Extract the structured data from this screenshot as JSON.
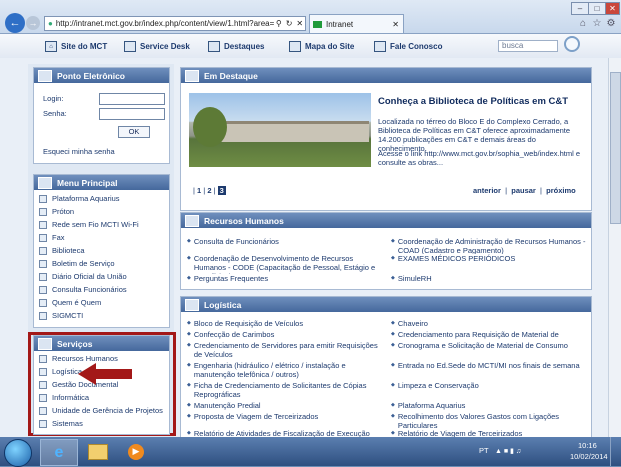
{
  "browser": {
    "url": "http://intranet.mct.gov.br/index.php/content/view/1.html?area=se",
    "tab_title": "Intranet"
  },
  "topnav": {
    "items": [
      "Site do MCT",
      "Service Desk",
      "Destaques",
      "Mapa do Site",
      "Fale Conosco"
    ],
    "search_placeholder": "busca"
  },
  "ponto": {
    "title": "Ponto Eletrônico",
    "login_label": "Login:",
    "senha_label": "Senha:",
    "ok_label": "OK",
    "forgot": "Esqueci minha senha"
  },
  "menu": {
    "title": "Menu Principal",
    "items": [
      "Plataforma Aquarius",
      "Próton",
      "Rede sem Fio MCTI Wi-Fi",
      "Fax",
      "Biblioteca",
      "Boletim de Serviço",
      "Diário Oficial da União",
      "Consulta Funcionários",
      "Quem é Quem",
      "SIGMCTI"
    ]
  },
  "servicos": {
    "title": "Serviços",
    "items": [
      "Recursos Humanos",
      "Logística",
      "Gestão Documental",
      "Informática",
      "Unidade de Gerência de Projetos",
      "Sistemas"
    ]
  },
  "destaque": {
    "title": "Em Destaque",
    "headline": "Conheça a Biblioteca de Políticas em C&T",
    "text": "Localizada no térreo do Bloco E do Complexo Cerrado, a Biblioteca de Políticas em C&T oferece aproximadamente 14.200 publicações em C&T e demais áreas do conhecimento.",
    "link_text": "Acesse o link http://www.mct.gov.br/sophia_web/index.html e consulte as obras...",
    "pages": [
      "1",
      "2",
      "3"
    ],
    "controls": [
      "anterior",
      "pausar",
      "próximo"
    ]
  },
  "rh": {
    "title": "Recursos Humanos",
    "left": [
      "Consulta de Funcionários",
      "Coordenação de Desenvolvimento de Recursos Humanos - CODE (Capacitação de Pessoal, Estágio e Benefícios)",
      "Perguntas Frequentes"
    ],
    "right": [
      "Coordenação de Administração de Recursos Humanos - COAD (Cadastro e Pagamento)",
      "EXAMES MÉDICOS PERIÓDICOS",
      "SimuleRH"
    ]
  },
  "logistica": {
    "title": "Logística",
    "left": [
      "Bloco de Requisição de Veículos",
      "Confecção de Carimbos",
      "Credenciamento de Servidores para emitir Requisições de Veículos",
      "Engenharia (hidráulico / elétrico / instalação e manutenção telefônica / outros)",
      "Ficha de Credenciamento de Solicitantes de Cópias Reprográficas",
      "Manutenção Predial",
      "Proposta de Viagem de Terceirizados",
      "Relatório de Atividades de Fiscalização de Execução Contratual"
    ],
    "right": [
      "Chaveiro",
      "Credenciamento para Requisição de Material de Consumo",
      "Cronograma e Solicitação de Material de Consumo",
      "Entrada no Ed.Sede do MCTI/MI nos finais de semana",
      "Limpeza e Conservação",
      "Plataforma Aquarius",
      "Recolhimento dos Valores Gastos com Ligações Particulares",
      "Relatório de Viagem de Terceirizados"
    ]
  },
  "taskbar": {
    "lang": "PT",
    "time": "10:16",
    "date": "10/02/2014"
  },
  "colors": {
    "header": "#4d70a3",
    "highlight": "#a31818"
  }
}
